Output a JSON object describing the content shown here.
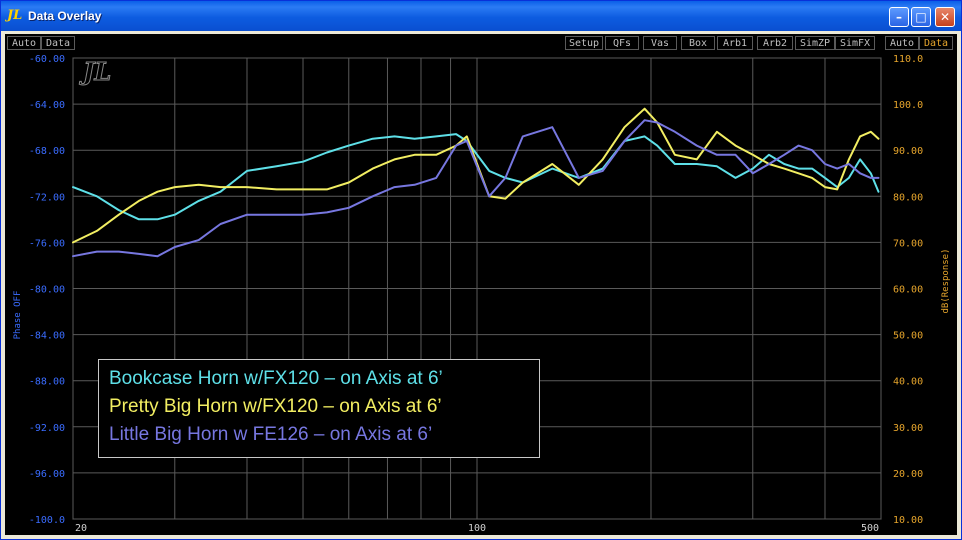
{
  "window": {
    "title": "Data Overlay",
    "logo": "JL",
    "controls": [
      "minimize-icon",
      "maximize-icon",
      "close-icon"
    ]
  },
  "toolbar": {
    "left": [
      "Auto",
      "Data"
    ],
    "right": [
      "Setup",
      "QFs",
      "Vas",
      "Box",
      "Arb1",
      "Arb2",
      "SimZP",
      "SimFX"
    ],
    "far_right": [
      "Auto",
      "Data"
    ]
  },
  "colors": {
    "left_axis": "#3a6cff",
    "right_axis": "#e6a52c",
    "series1": "#5ee0e8",
    "series2": "#f2ee62",
    "series3": "#7777e0"
  },
  "chart_data": {
    "type": "line",
    "xscale": "log",
    "xlim": [
      20,
      500
    ],
    "x_tick_labels": [
      "20",
      "100",
      "500"
    ],
    "ylim_left": [
      -100,
      -60
    ],
    "yticks_left": [
      "-60.00",
      "-64.00",
      "-68.00",
      "-72.00",
      "-76.00",
      "-80.00",
      "-84.00",
      "-88.00",
      "-92.00",
      "-96.00",
      "-100.0"
    ],
    "ylabel_left": "Phase OFF",
    "ylim_right": [
      10,
      110
    ],
    "yticks_right": [
      "110.0",
      "100.0",
      "90.00",
      "80.00",
      "70.00",
      "60.00",
      "50.00",
      "40.00",
      "30.00",
      "20.00",
      "10.00"
    ],
    "ylabel_right": "dB(Response)",
    "grid": true,
    "series": [
      {
        "name": "Bookcase Horn w/FX120 – on Axis at 6’",
        "color": "#5ee0e8",
        "points": [
          [
            20,
            82
          ],
          [
            22,
            80
          ],
          [
            24,
            77
          ],
          [
            26,
            75
          ],
          [
            28,
            75
          ],
          [
            30,
            76
          ],
          [
            33,
            79
          ],
          [
            36,
            81
          ],
          [
            40,
            85.5
          ],
          [
            45,
            86.5
          ],
          [
            50,
            87.5
          ],
          [
            55,
            89.5
          ],
          [
            60,
            91
          ],
          [
            66,
            92.5
          ],
          [
            72,
            93
          ],
          [
            78,
            92.5
          ],
          [
            85,
            93
          ],
          [
            92,
            93.5
          ],
          [
            96,
            92
          ],
          [
            105,
            85.5
          ],
          [
            112,
            84
          ],
          [
            120,
            83
          ],
          [
            135,
            86
          ],
          [
            150,
            84
          ],
          [
            165,
            86
          ],
          [
            180,
            92
          ],
          [
            195,
            93
          ],
          [
            205,
            91
          ],
          [
            220,
            87
          ],
          [
            240,
            87
          ],
          [
            260,
            86.5
          ],
          [
            280,
            84
          ],
          [
            300,
            86
          ],
          [
            320,
            89
          ],
          [
            340,
            87
          ],
          [
            360,
            86
          ],
          [
            380,
            86
          ],
          [
            400,
            84
          ],
          [
            420,
            82
          ],
          [
            440,
            84
          ],
          [
            460,
            88
          ],
          [
            480,
            85
          ],
          [
            495,
            81
          ]
        ]
      },
      {
        "name": "Pretty Big Horn w/FX120 – on Axis at 6’",
        "color": "#f2ee62",
        "points": [
          [
            20,
            70
          ],
          [
            22,
            72.5
          ],
          [
            24,
            76
          ],
          [
            26,
            79
          ],
          [
            28,
            81
          ],
          [
            30,
            82
          ],
          [
            33,
            82.5
          ],
          [
            36,
            82
          ],
          [
            40,
            82
          ],
          [
            45,
            81.5
          ],
          [
            50,
            81.5
          ],
          [
            55,
            81.5
          ],
          [
            60,
            83
          ],
          [
            66,
            86
          ],
          [
            72,
            88
          ],
          [
            78,
            89
          ],
          [
            85,
            89
          ],
          [
            92,
            91
          ],
          [
            96,
            93
          ],
          [
            105,
            80
          ],
          [
            112,
            79.5
          ],
          [
            120,
            83
          ],
          [
            135,
            87
          ],
          [
            150,
            82.5
          ],
          [
            165,
            88
          ],
          [
            180,
            95
          ],
          [
            195,
            99
          ],
          [
            205,
            96
          ],
          [
            220,
            89
          ],
          [
            240,
            88
          ],
          [
            260,
            94
          ],
          [
            280,
            91
          ],
          [
            300,
            89
          ],
          [
            320,
            87
          ],
          [
            340,
            86
          ],
          [
            360,
            85
          ],
          [
            380,
            84
          ],
          [
            400,
            82
          ],
          [
            420,
            81.5
          ],
          [
            440,
            88
          ],
          [
            460,
            93
          ],
          [
            480,
            94
          ],
          [
            495,
            92.5
          ]
        ]
      },
      {
        "name": "Little Big Horn w FE126 – on Axis at 6’",
        "color": "#7777e0",
        "points": [
          [
            20,
            67
          ],
          [
            22,
            68
          ],
          [
            24,
            68
          ],
          [
            26,
            67.5
          ],
          [
            28,
            67
          ],
          [
            30,
            69
          ],
          [
            33,
            70.5
          ],
          [
            36,
            74
          ],
          [
            40,
            76
          ],
          [
            45,
            76
          ],
          [
            50,
            76
          ],
          [
            55,
            76.5
          ],
          [
            60,
            77.5
          ],
          [
            66,
            80
          ],
          [
            72,
            82
          ],
          [
            78,
            82.5
          ],
          [
            85,
            84
          ],
          [
            92,
            91
          ],
          [
            96,
            92
          ],
          [
            105,
            80
          ],
          [
            112,
            84
          ],
          [
            120,
            93
          ],
          [
            135,
            95
          ],
          [
            150,
            84
          ],
          [
            165,
            85.5
          ],
          [
            180,
            92
          ],
          [
            195,
            96.5
          ],
          [
            205,
            96
          ],
          [
            220,
            94
          ],
          [
            240,
            91
          ],
          [
            260,
            89
          ],
          [
            280,
            89
          ],
          [
            300,
            85
          ],
          [
            320,
            87
          ],
          [
            340,
            89
          ],
          [
            360,
            91
          ],
          [
            380,
            90
          ],
          [
            400,
            87
          ],
          [
            420,
            86
          ],
          [
            440,
            87
          ],
          [
            460,
            85
          ],
          [
            480,
            84
          ],
          [
            495,
            84
          ]
        ]
      }
    ]
  }
}
